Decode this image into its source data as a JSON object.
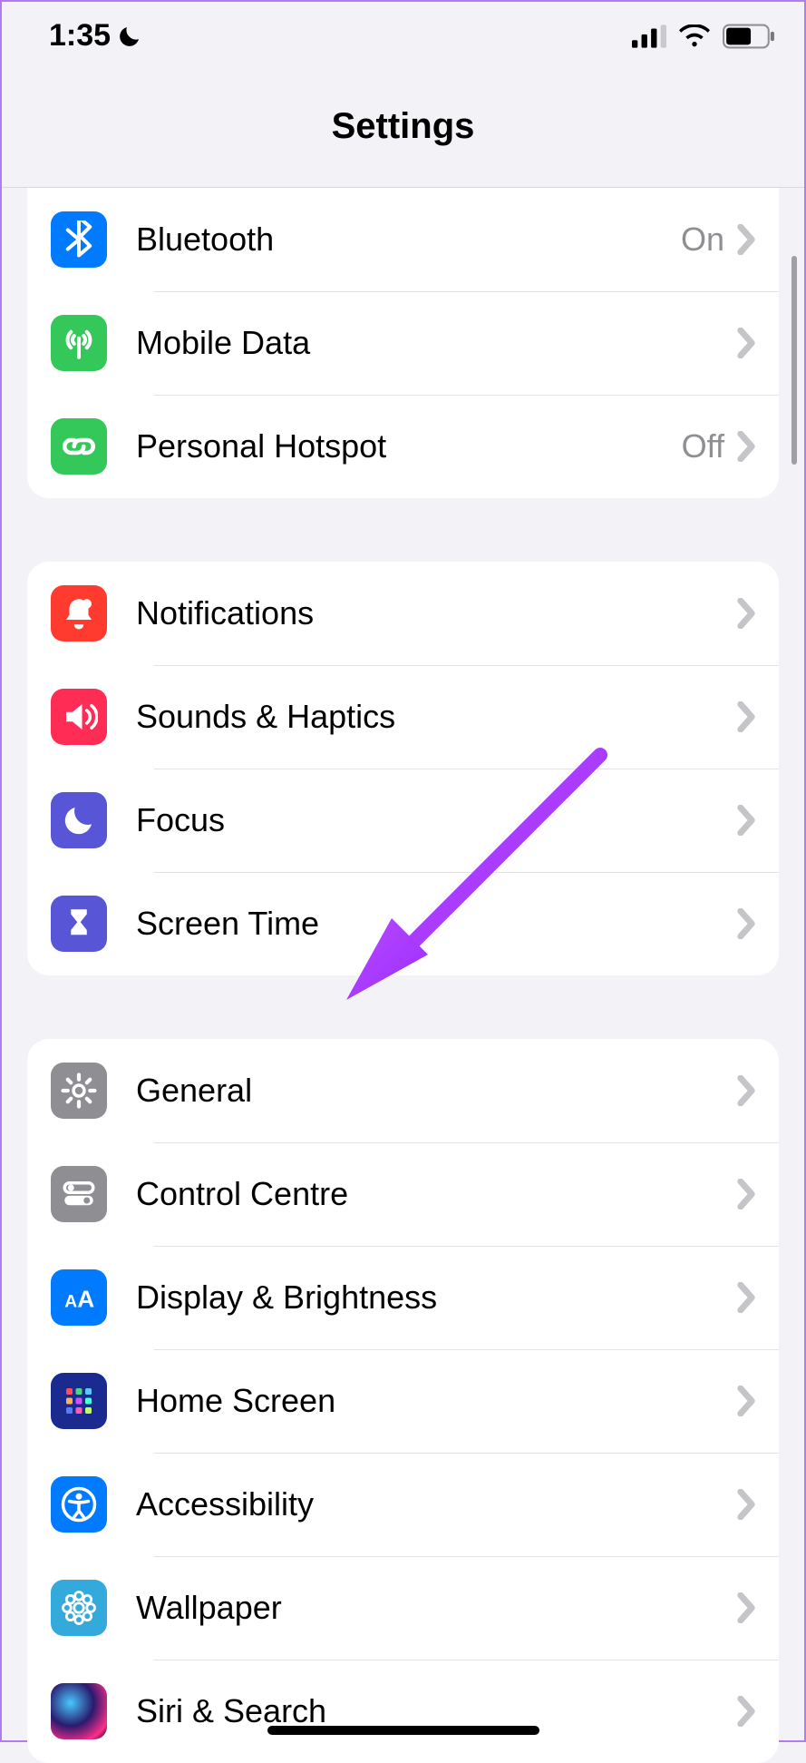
{
  "status": {
    "time": "1:35"
  },
  "header": {
    "title": "Settings"
  },
  "groups": [
    {
      "rows": [
        {
          "icon": "bluetooth",
          "label": "Bluetooth",
          "value": "On"
        },
        {
          "icon": "antenna",
          "label": "Mobile Data",
          "value": ""
        },
        {
          "icon": "link",
          "label": "Personal Hotspot",
          "value": "Off"
        }
      ]
    },
    {
      "rows": [
        {
          "icon": "bell",
          "label": "Notifications"
        },
        {
          "icon": "speaker",
          "label": "Sounds & Haptics"
        },
        {
          "icon": "moon",
          "label": "Focus"
        },
        {
          "icon": "hourglass",
          "label": "Screen Time"
        }
      ]
    },
    {
      "rows": [
        {
          "icon": "gear",
          "label": "General"
        },
        {
          "icon": "switches",
          "label": "Control Centre"
        },
        {
          "icon": "aa",
          "label": "Display & Brightness"
        },
        {
          "icon": "grid",
          "label": "Home Screen"
        },
        {
          "icon": "person",
          "label": "Accessibility"
        },
        {
          "icon": "flower",
          "label": "Wallpaper"
        },
        {
          "icon": "siri",
          "label": "Siri & Search"
        }
      ]
    }
  ],
  "annotation": {
    "target": "Control Centre"
  }
}
